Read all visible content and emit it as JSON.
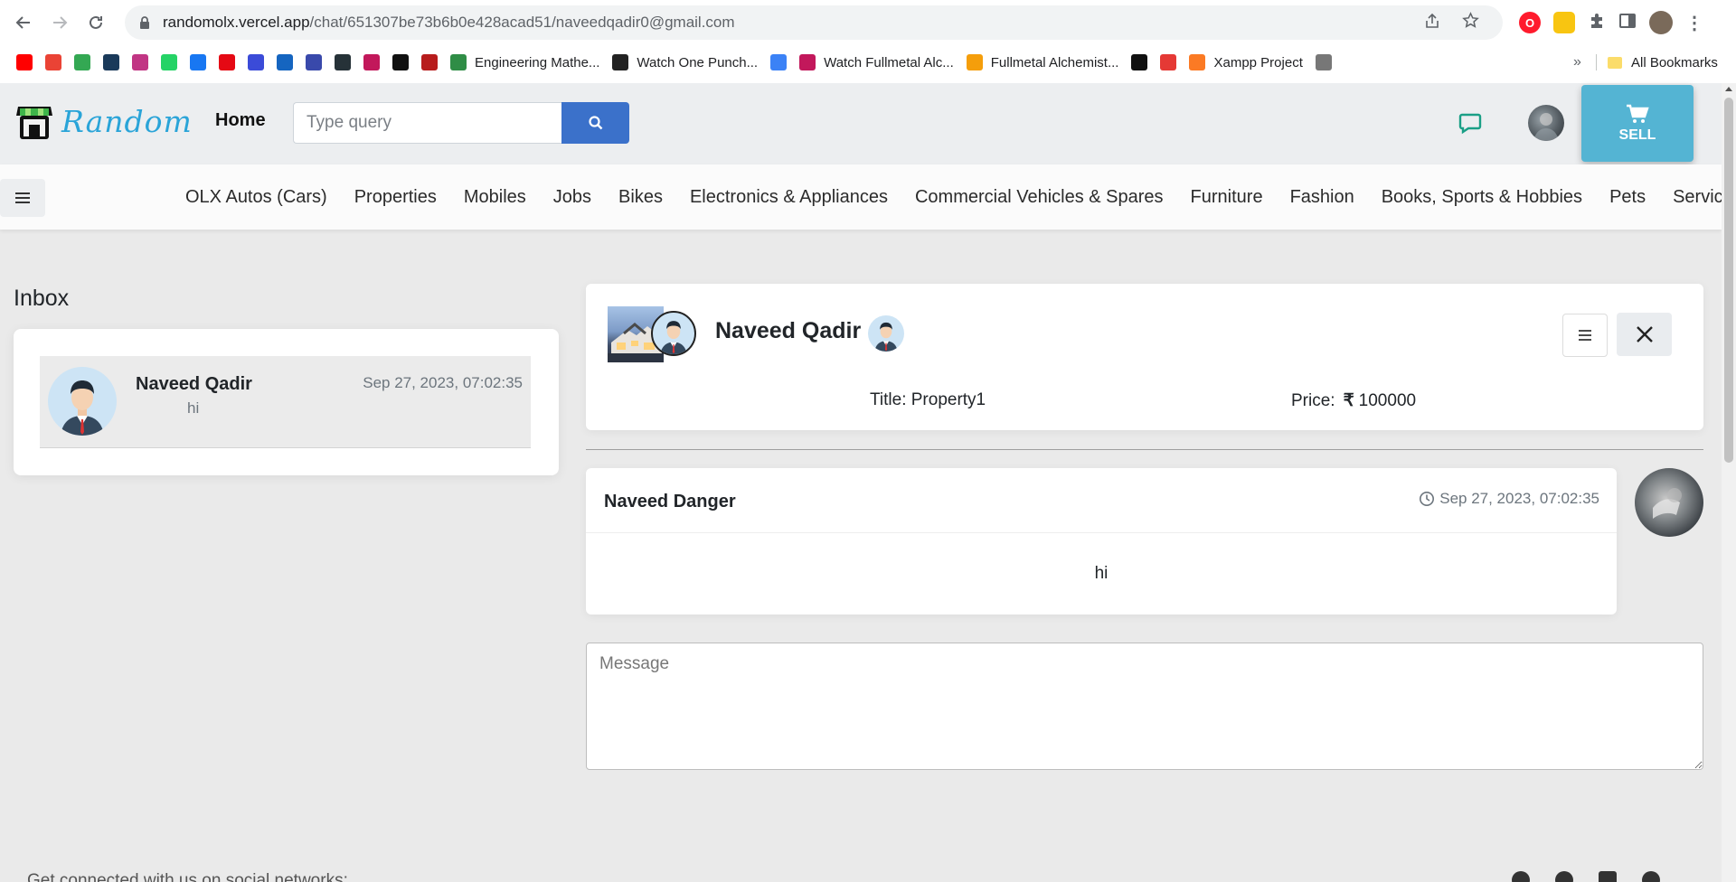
{
  "browser": {
    "url_host": "randomolx.vercel.app",
    "url_path": "/chat/651307be73b6b0e428acad51/naveedqadir0@gmail.com",
    "bookmarks": [
      {
        "label": "",
        "icon": "youtube-icon",
        "color": "#ff0000"
      },
      {
        "label": "",
        "icon": "gmail-icon",
        "color": "#ea4335"
      },
      {
        "label": "",
        "icon": "maps-icon",
        "color": "#34a853"
      },
      {
        "label": "",
        "icon": "app-icon",
        "color": "#1a3a5a"
      },
      {
        "label": "",
        "icon": "instagram-icon",
        "color": "#c13584"
      },
      {
        "label": "",
        "icon": "whatsapp-icon",
        "color": "#25d366"
      },
      {
        "label": "",
        "icon": "facebook-icon",
        "color": "#1877f2"
      },
      {
        "label": "",
        "icon": "netflix-icon",
        "color": "#e50914"
      },
      {
        "label": "",
        "icon": "u-icon",
        "color": "#3b4bd8"
      },
      {
        "label": "",
        "icon": "play-icon",
        "color": "#1565c0"
      },
      {
        "label": "",
        "icon": "grid-icon",
        "color": "#3949ab"
      },
      {
        "label": "",
        "icon": "grid-icon-2",
        "color": "#263238"
      },
      {
        "label": "",
        "icon": "play-circle-icon",
        "color": "#c2185b"
      },
      {
        "label": "",
        "icon": "udemy-icon",
        "color": "#111111"
      },
      {
        "label": "",
        "icon": "ez-icon",
        "color": "#b71c1c"
      },
      {
        "label": "Engineering Mathe...",
        "icon": "gfg-icon",
        "color": "#2f8d46"
      },
      {
        "label": "Watch One Punch...",
        "icon": "shield-icon",
        "color": "#222222"
      },
      {
        "label": "",
        "icon": "play-blue-icon",
        "color": "#3b82f6"
      },
      {
        "label": "Watch Fullmetal Alc...",
        "icon": "play-red-icon",
        "color": "#c2185b"
      },
      {
        "label": "Fullmetal Alchemist...",
        "icon": "colorful-icon",
        "color": "#f59e0b"
      },
      {
        "label": "",
        "icon": "swoosh-icon",
        "color": "#111111"
      },
      {
        "label": "",
        "icon": "colorful-icon-2",
        "color": "#e53935"
      },
      {
        "label": "Xampp Project",
        "icon": "xampp-icon",
        "color": "#fb7a24"
      },
      {
        "label": "",
        "icon": "dash-icon",
        "color": "#777777"
      }
    ],
    "more": "»",
    "all_bookmarks": "All Bookmarks"
  },
  "header": {
    "logo_text": "Random",
    "home": "Home",
    "search_placeholder": "Type query",
    "sell_label": "SELL"
  },
  "categories": [
    "OLX Autos (Cars)",
    "Properties",
    "Mobiles",
    "Jobs",
    "Bikes",
    "Electronics & Appliances",
    "Commercial Vehicles & Spares",
    "Furniture",
    "Fashion",
    "Books, Sports & Hobbies",
    "Pets",
    "Services"
  ],
  "inbox": {
    "title": "Inbox",
    "conversations": [
      {
        "name": "Naveed Qadir",
        "time": "Sep 27, 2023, 07:02:35",
        "last_message": "hi"
      }
    ]
  },
  "chat": {
    "seller_name": "Naveed Qadir",
    "title_label": "Title:",
    "title_value": "Property1",
    "price_label": "Price:",
    "currency": "₹",
    "price_value": "100000",
    "messages": [
      {
        "sender": "Naveed Danger",
        "time": "Sep 27, 2023, 07:02:35",
        "text": "hi"
      }
    ],
    "message_placeholder": "Message"
  },
  "footer": {
    "text": "Get connected with us on social networks:"
  }
}
